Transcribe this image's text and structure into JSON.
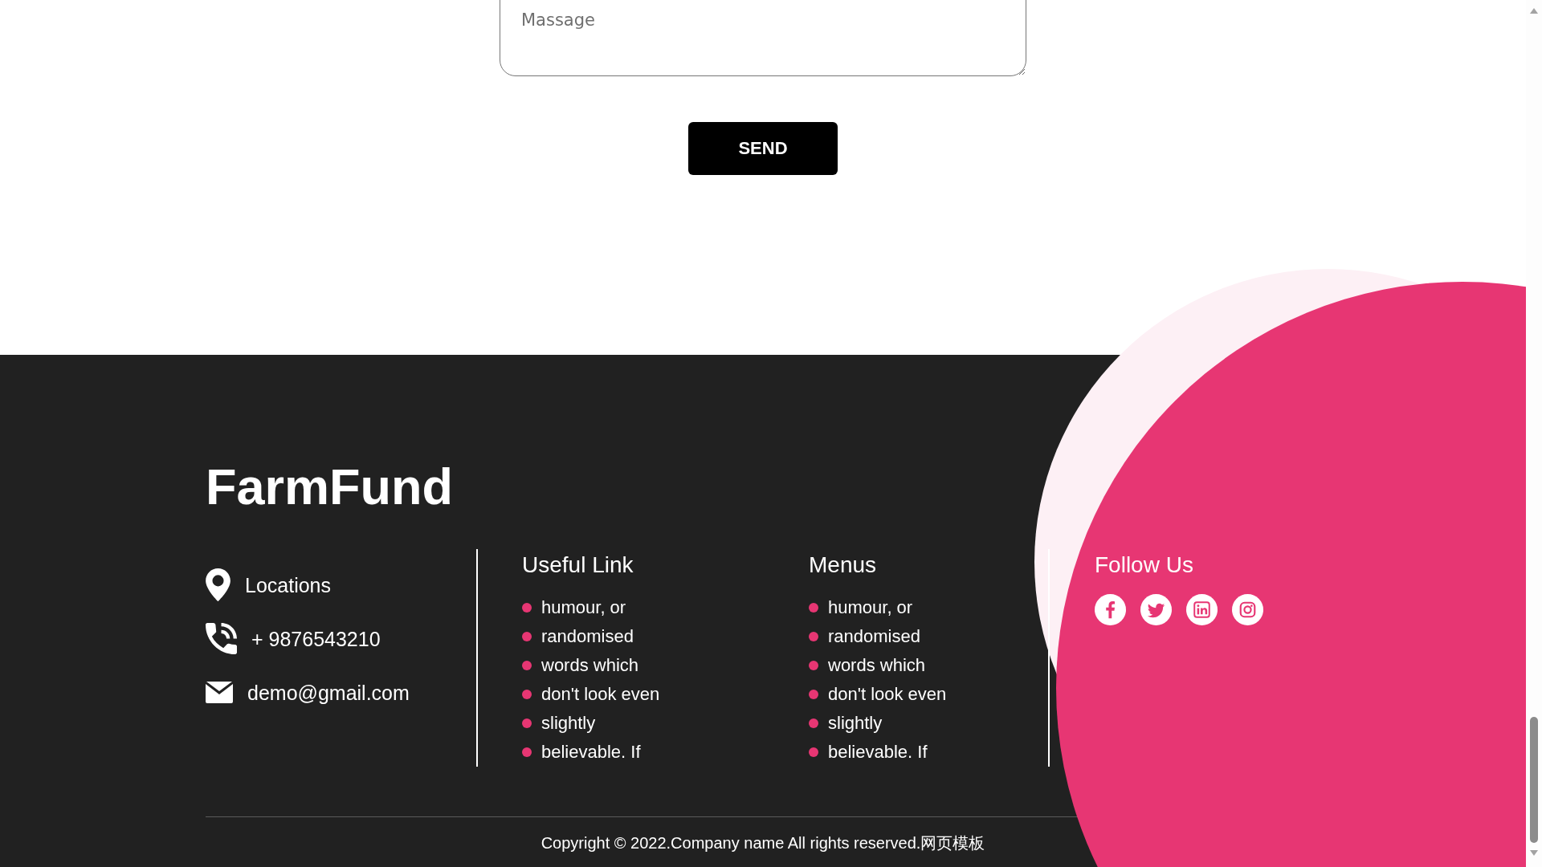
{
  "contact_form": {
    "message": {
      "placeholder": "Massage"
    },
    "submit_button": "SEND"
  },
  "footer": {
    "brand": "FarmFund",
    "contacts": [
      {
        "kind": "location",
        "text": "Locations"
      },
      {
        "kind": "phone",
        "text": "+ 9876543210"
      },
      {
        "kind": "email",
        "text": "demo@gmail.com"
      }
    ],
    "link_columns": [
      {
        "heading": "Useful Link",
        "links": [
          "humour, or",
          "randomised",
          "words which",
          "don't look even",
          "slightly",
          "believable. If"
        ]
      },
      {
        "heading": "Menus",
        "links": [
          "humour, or",
          "randomised",
          "words which",
          "don't look even",
          "slightly",
          "believable. If"
        ]
      }
    ],
    "follow": {
      "heading": "Follow Us",
      "social_links": [
        {
          "kind": "facebook"
        },
        {
          "kind": "twitter"
        },
        {
          "kind": "linkedin"
        },
        {
          "kind": "instagram"
        }
      ]
    },
    "copyright": "Copyright © 2022.Company name All rights reserved.网页模板"
  }
}
